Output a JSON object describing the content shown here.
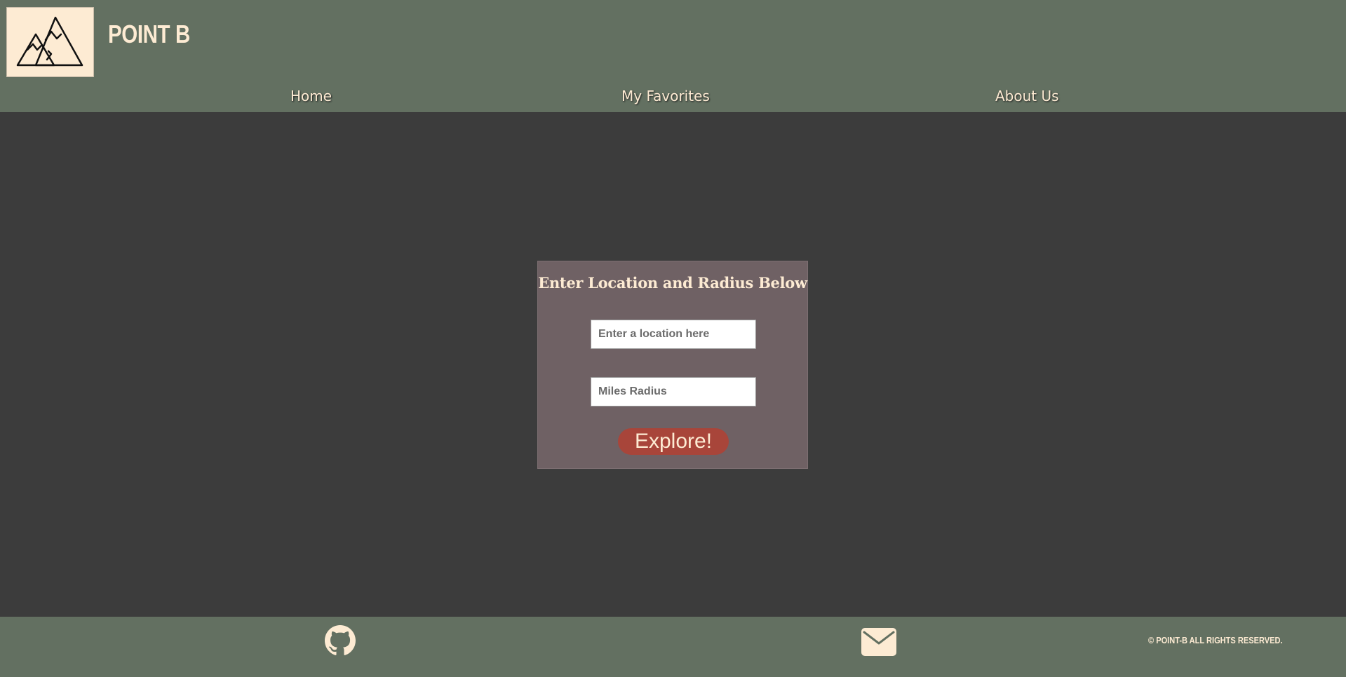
{
  "header": {
    "brand": "POINT B",
    "logo_icon": "mountains-icon"
  },
  "nav": {
    "items": [
      {
        "label": "Home"
      },
      {
        "label": "My Favorites"
      },
      {
        "label": "About Us"
      }
    ]
  },
  "search": {
    "title": "Enter Location and Radius Below",
    "location_placeholder": "Enter a location here",
    "location_value": "",
    "radius_placeholder": "Miles Radius",
    "radius_value": "",
    "button_label": "Explore!"
  },
  "footer": {
    "icons": [
      "github-icon",
      "mail-icon"
    ],
    "copyright": "© POINT-B ALL RIGHTS RESERVED."
  },
  "colors": {
    "header_bg": "#637061",
    "page_bg": "#3c3c3c",
    "cream": "#fdebd3",
    "card_bg": "#6f6164",
    "button_bg": "#a8453a"
  }
}
